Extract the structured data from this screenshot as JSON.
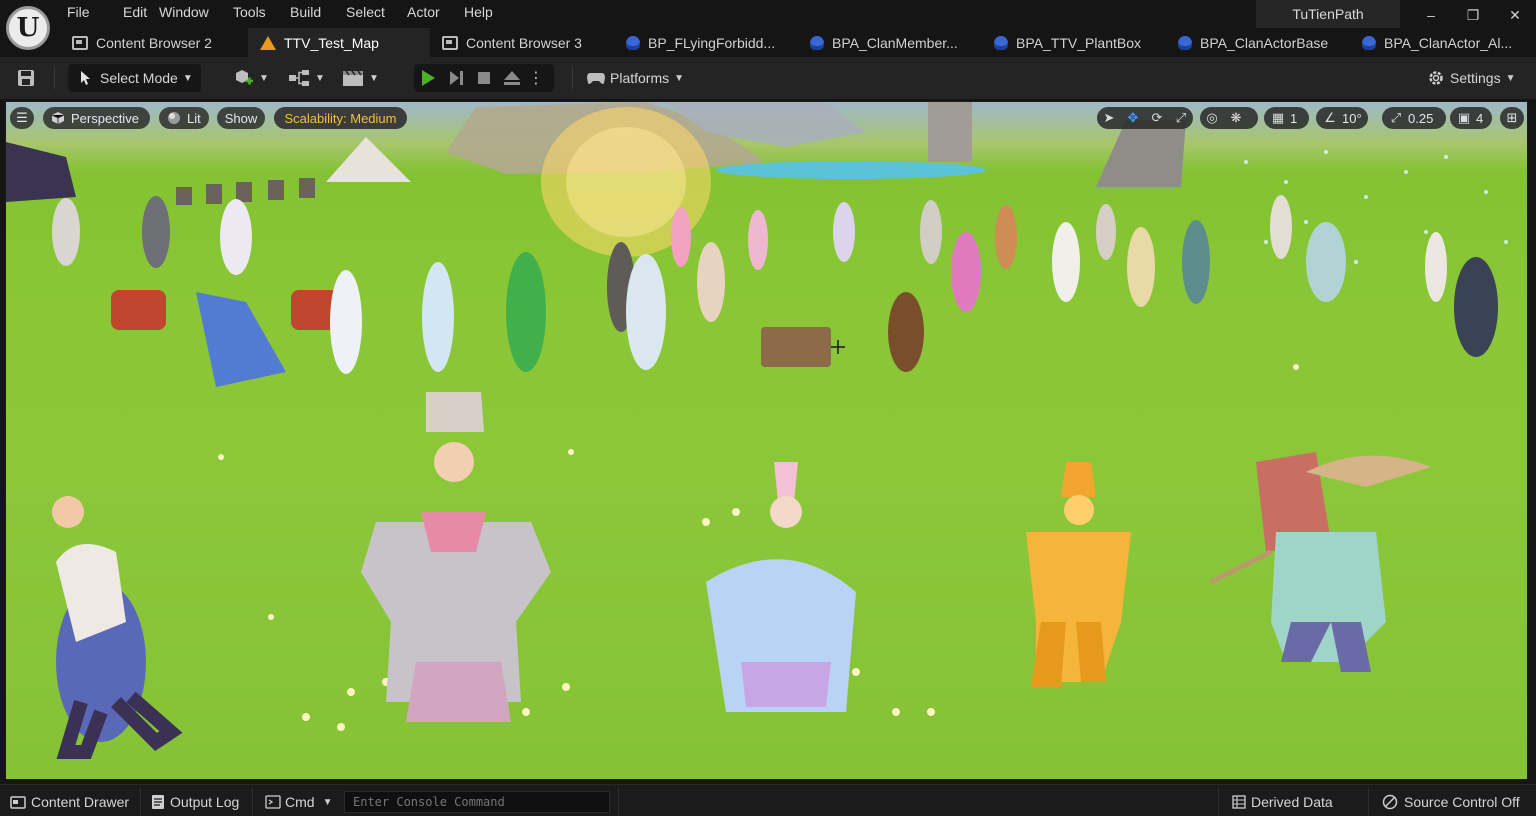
{
  "app": {
    "project_name": "TuTienPath",
    "logo_letter": "U"
  },
  "menu": [
    "File",
    "Edit",
    "Window",
    "Tools",
    "Build",
    "Select",
    "Actor",
    "Help"
  ],
  "tabs": [
    {
      "label": "Content Browser 2",
      "icon": "content-browser-icon",
      "active": false
    },
    {
      "label": "TTV_Test_Map",
      "icon": "level-map-icon",
      "active": true
    },
    {
      "label": "Content Browser 3",
      "icon": "content-browser-icon",
      "active": false
    },
    {
      "label": "BP_FLyingForbidd...",
      "icon": "blueprint-icon",
      "active": false
    },
    {
      "label": "BPA_ClanMember...",
      "icon": "blueprint-icon",
      "active": false
    },
    {
      "label": "BPA_TTV_PlantBox",
      "icon": "blueprint-icon",
      "active": false
    },
    {
      "label": "BPA_ClanActorBase",
      "icon": "blueprint-icon",
      "active": false
    },
    {
      "label": "BPA_ClanActor_Al...",
      "icon": "blueprint-icon",
      "active": false
    }
  ],
  "toolbar": {
    "select_mode": "Select Mode",
    "platforms": "Platforms",
    "settings": "Settings"
  },
  "viewport": {
    "perspective": "Perspective",
    "lit": "Lit",
    "show": "Show",
    "scalability": "Scalability: Medium",
    "grid_snap": "1",
    "rotation_snap": "10°",
    "scale_snap": "0.25",
    "camera_speed": "4"
  },
  "statusbar": {
    "content_drawer": "Content Drawer",
    "output_log": "Output Log",
    "cmd": "Cmd",
    "console_placeholder": "Enter Console Command",
    "derived_data": "Derived Data",
    "source_control": "Source Control Off"
  },
  "colors": {
    "accent_play": "#4caf2a",
    "accent_blue": "#3d9bff",
    "scalability_text": "#f1c232",
    "grass": "#8cc73a"
  }
}
